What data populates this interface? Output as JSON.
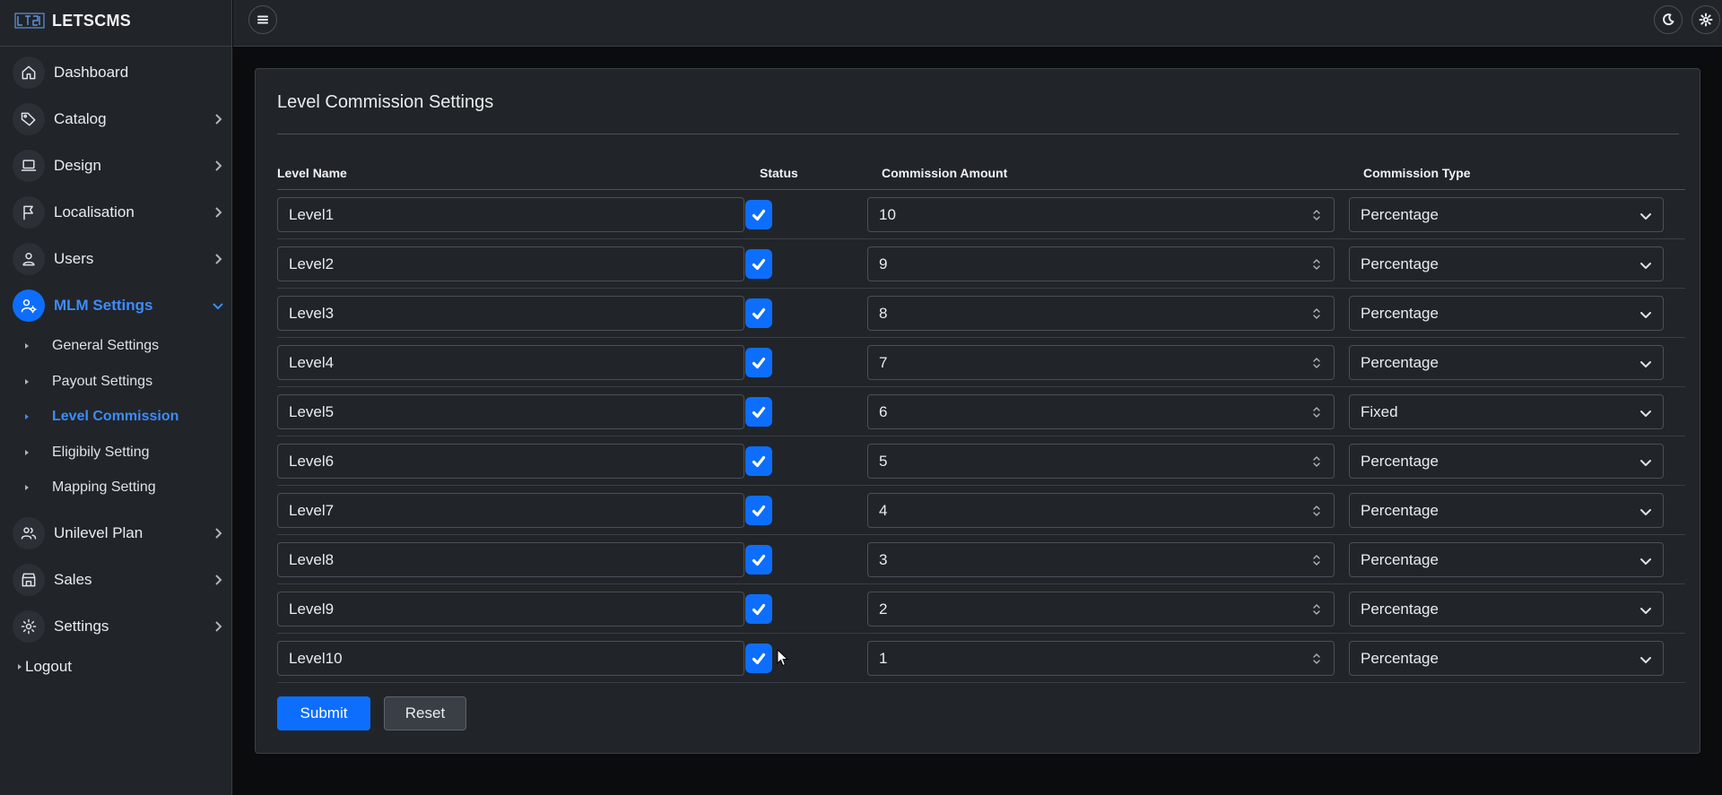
{
  "brand": {
    "name": "LETSCMS"
  },
  "sidebar": {
    "items": [
      {
        "key": "dashboard",
        "label": "Dashboard",
        "icon": "home-icon",
        "has_children": false
      },
      {
        "key": "catalog",
        "label": "Catalog",
        "icon": "tag-icon",
        "has_children": true
      },
      {
        "key": "design",
        "label": "Design",
        "icon": "laptop-icon",
        "has_children": true
      },
      {
        "key": "localisation",
        "label": "Localisation",
        "icon": "flag-icon",
        "has_children": true
      },
      {
        "key": "users",
        "label": "Users",
        "icon": "user-icon",
        "has_children": true
      },
      {
        "key": "mlm",
        "label": "MLM Settings",
        "icon": "user-gear-icon",
        "has_children": true,
        "expanded": true
      }
    ],
    "mlm_children": [
      {
        "label": "General Settings"
      },
      {
        "label": "Payout Settings"
      },
      {
        "label": "Level Commission",
        "current": true
      },
      {
        "label": "Eligibily Setting"
      },
      {
        "label": "Mapping Setting"
      }
    ],
    "items_after": [
      {
        "key": "unilevel",
        "label": "Unilevel Plan",
        "icon": "users-icon",
        "has_children": true
      },
      {
        "key": "sales",
        "label": "Sales",
        "icon": "store-icon",
        "has_children": true
      },
      {
        "key": "settings",
        "label": "Settings",
        "icon": "gear-icon",
        "has_children": true
      }
    ],
    "logout": "Logout"
  },
  "topbar": {
    "menu_icon": "hamburger-icon",
    "theme_icon": "moon-icon",
    "settings_icon": "gear-icon"
  },
  "card": {
    "title": "Level Commission Settings",
    "headers": {
      "level_name": "Level Name",
      "status": "Status",
      "commission_amount": "Commission Amount",
      "commission_type": "Commission Type"
    },
    "rows": [
      {
        "name": "Level1",
        "status": true,
        "amount": "10",
        "type": "Percentage"
      },
      {
        "name": "Level2",
        "status": true,
        "amount": "9",
        "type": "Percentage"
      },
      {
        "name": "Level3",
        "status": true,
        "amount": "8",
        "type": "Percentage"
      },
      {
        "name": "Level4",
        "status": true,
        "amount": "7",
        "type": "Percentage"
      },
      {
        "name": "Level5",
        "status": true,
        "amount": "6",
        "type": "Fixed"
      },
      {
        "name": "Level6",
        "status": true,
        "amount": "5",
        "type": "Percentage"
      },
      {
        "name": "Level7",
        "status": true,
        "amount": "4",
        "type": "Percentage"
      },
      {
        "name": "Level8",
        "status": true,
        "amount": "3",
        "type": "Percentage"
      },
      {
        "name": "Level9",
        "status": true,
        "amount": "2",
        "type": "Percentage"
      },
      {
        "name": "Level10",
        "status": true,
        "amount": "1",
        "type": "Percentage"
      }
    ],
    "submit_label": "Submit",
    "reset_label": "Reset"
  },
  "colors": {
    "accent": "#0d6efd",
    "active_text": "#3d8bfd",
    "surface": "#212529",
    "background": "#0b0c0e"
  }
}
